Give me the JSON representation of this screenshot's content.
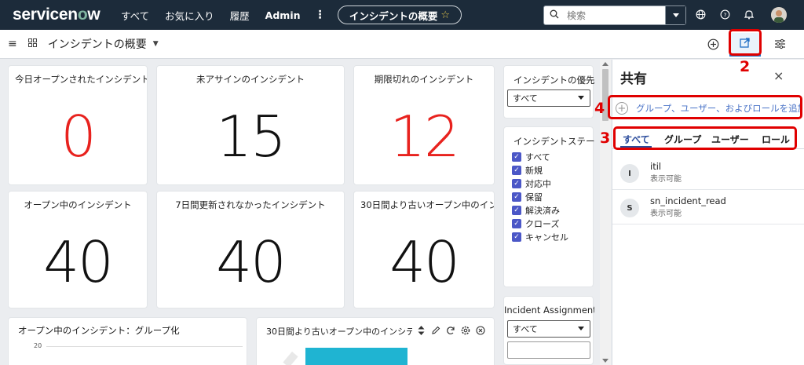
{
  "topnav": {
    "logo_prefix": "servicen",
    "logo_o": "o",
    "logo_suffix": "w",
    "items": [
      "すべて",
      "お気に入り",
      "履歴",
      "Admin"
    ],
    "more": "⋮",
    "title_pill": "インシデントの概要",
    "search_placeholder": "検索"
  },
  "subbar": {
    "dashboard_title": "インシデントの概要"
  },
  "cards": [
    {
      "title": "今日オープンされたインシデント",
      "value": "0",
      "color": "#e8221e"
    },
    {
      "title": "未アサインのインシデント",
      "value": "15",
      "color": "#111111"
    },
    {
      "title": "期限切れのインシデント",
      "value": "12",
      "color": "#e8221e"
    },
    {
      "title": "オープン中のインシデント",
      "value": "40",
      "color": "#111111"
    },
    {
      "title": "7日間更新されなかったインシデント",
      "value": "40",
      "color": "#111111"
    },
    {
      "title": "30日間より古いオープン中のイン",
      "value": "40",
      "color": "#111111"
    }
  ],
  "filters": {
    "priority": {
      "title": "インシデントの優先",
      "selected": "すべて"
    },
    "state": {
      "title": "インシデントステー",
      "options": [
        "すべて",
        "新規",
        "対応中",
        "保留",
        "解決済み",
        "クローズ",
        "キャンセル"
      ]
    },
    "assignment": {
      "title": "Incident Assignment",
      "selected": "すべて"
    }
  },
  "bottom_widgets": {
    "group_title": "オープン中のインシデント：グループ化",
    "group_axis_tick": "20",
    "old_title": "30日間より古いオープン中のインシデ"
  },
  "share_panel": {
    "title": "共有",
    "close": "×",
    "add_text": "グループ、ユーザー、およびロールを追加",
    "tabs": [
      "すべて",
      "グループ",
      "ユーザー",
      "ロール"
    ],
    "entries": [
      {
        "initial": "I",
        "name": "itil",
        "status": "表示可能"
      },
      {
        "initial": "S",
        "name": "sn_incident_read",
        "status": "表示可能"
      }
    ]
  },
  "annotations": [
    "2",
    "3",
    "4"
  ],
  "colors": {
    "nav": "#1c2b3a",
    "accent": "#2b4c9c",
    "annotation": "#e00000",
    "alert": "#e8221e"
  }
}
